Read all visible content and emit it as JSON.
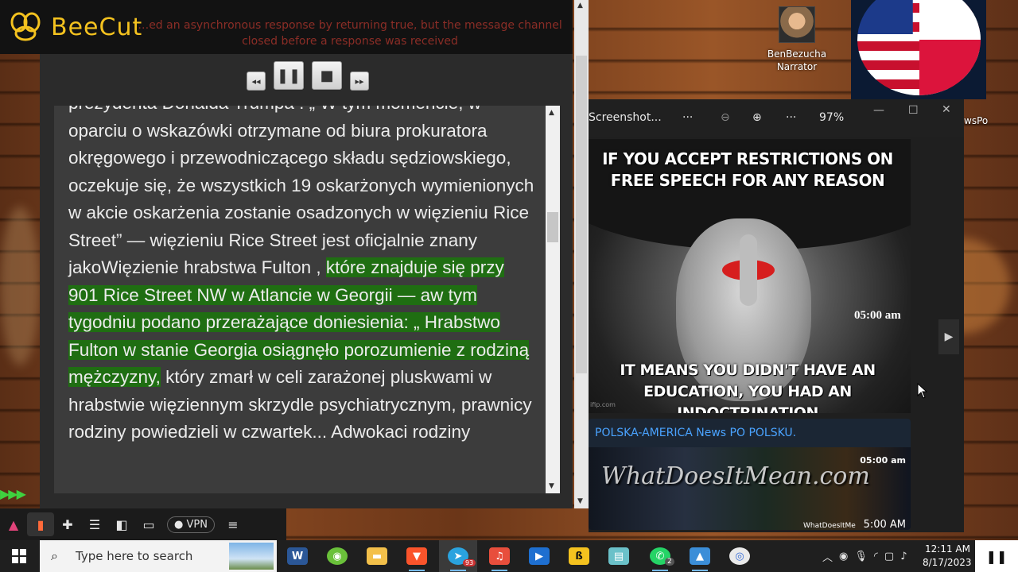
{
  "beecut": {
    "app_name": "BeeCut",
    "error_message": "…ed an asynchronous response by returning true, but the message channel closed before a response was received"
  },
  "reader": {
    "controls": {
      "rewind": "◂◂",
      "pause": "❚❚",
      "stop": "■",
      "forward": "▸▸"
    },
    "text_before": "prezydenta Donalda Trumpa : „ W tym momencie, w oparciu o wskazówki otrzymane od biura prokuratora okręgowego i przewodniczącego składu sędziowskiego, oczekuje się, że wszystkich 19 oskarżonych wymienionych w akcie oskarżenia zostanie osadzonych w więzieniu Rice Street” — więzieniu Rice Street jest oficjalnie znany jakoWięzienie hrabstwa Fulton ,",
    "text_highlight": "które znajduje się przy 901 Rice Street NW w Atlancie w Georgii — aw tym tygodniu podano przerażające doniesienia: „ Hrabstwo Fulton w stanie Georgia osiągnęło porozumienie z rodziną mężczyzny,",
    "text_after": "który zmarł w celi zarażonej pluskwami w hrabstwie więziennym skrzydle psychiatrycznym, prawnicy rodziny powiedzieli w czwartek... Adwokaci rodziny"
  },
  "narrator": {
    "name": "BenBezucha",
    "role": "Narrator"
  },
  "viewer": {
    "title": "Screenshot...",
    "more1": "···",
    "more2": "···",
    "zoom": "97%",
    "side_label": "wsPo"
  },
  "meme": {
    "top_text": "IF YOU ACCEPT RESTRICTIONS ON FREE SPEECH FOR ANY REASON",
    "bottom_text": "IT MEANS YOU DIDN'T HAVE AN EDUCATION, YOU HAD AN INDOCTRINATION",
    "time": "05:00 am",
    "credit": "ifip.com"
  },
  "news": {
    "title": "POLSKA-AMERICA News PO POLSKU.",
    "watermark": "WhatDoesItMean.com",
    "time_top": "05:00 am",
    "time_bottom": "5:00 AM",
    "site": "WhatDoesItMe"
  },
  "toolbar": {
    "vpn_label": "VPN"
  },
  "taskbar": {
    "search_placeholder": "Type here to search",
    "telegram_badge": "93",
    "whatsapp_badge": "2",
    "time": "12:11 AM",
    "date": "8/17/2023"
  },
  "colors": {
    "beecut_yellow": "#f4c21f",
    "highlight_green": "#1f6e12",
    "news_blue": "#4aa3ff"
  }
}
